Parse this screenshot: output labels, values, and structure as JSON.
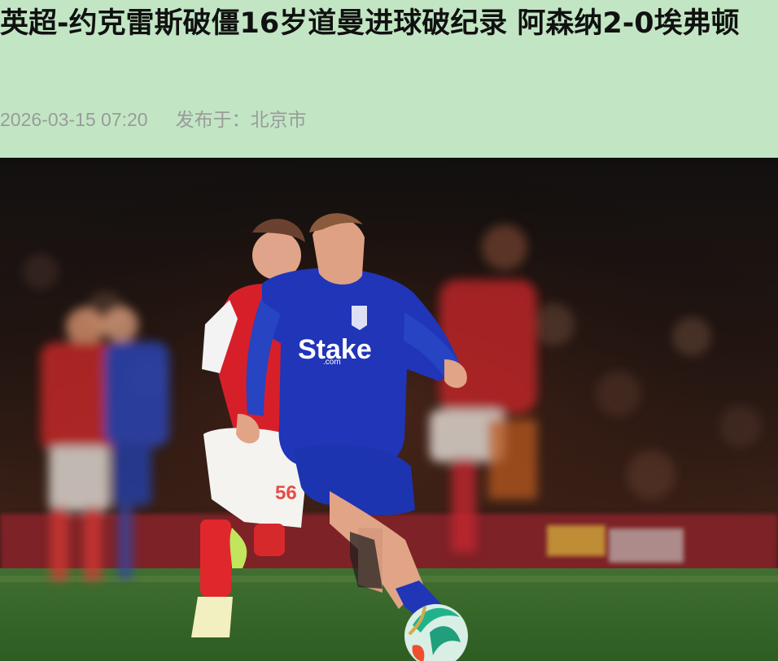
{
  "article": {
    "title": "英超-约克雷斯破僵16岁道曼进球破纪录 阿森纳2-0埃弗顿",
    "publish_time": "2026-03-15 07:20",
    "location_label": "发布于：北京市"
  },
  "photo": {
    "sponsor_text": "Stake",
    "sponsor_subtext": ".com",
    "shirt_number": "56",
    "colors": {
      "header_bg": "#c2e6c4",
      "everton_blue": "#2035b8",
      "arsenal_red": "#d21f2a",
      "pitch_green": "#3f6f2c"
    }
  }
}
